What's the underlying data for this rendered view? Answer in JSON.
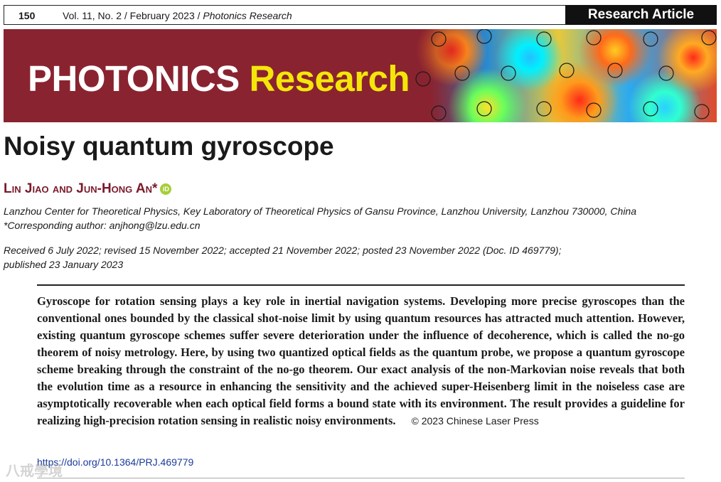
{
  "header": {
    "page_number": "150",
    "journal_ref": "Vol. 11, No. 2 / February 2023 / ",
    "journal_name": "Photonics Research",
    "article_type": "Research Article"
  },
  "banner": {
    "logo_part1": "PHOTONICS",
    "logo_part2": "Research"
  },
  "paper": {
    "title": "Noisy quantum gyroscope",
    "authors": "Lin Jiao and Jun-Hong An*",
    "orcid_badge": "iD",
    "affiliation": "Lanzhou Center for Theoretical Physics, Key Laboratory of Theoretical Physics of Gansu Province, Lanzhou University, Lanzhou 730000, China",
    "corresponding": "*Corresponding author: anjhong@lzu.edu.cn",
    "dates_line1": "Received 6 July 2022; revised 15 November 2022; accepted 21 November 2022; posted 23 November 2022 (Doc. ID 469779);",
    "dates_line2": "published 23 January 2023",
    "abstract": "Gyroscope for rotation sensing plays a key role in inertial navigation systems. Developing more precise gyroscopes than the conventional ones bounded by the classical shot-noise limit by using quantum resources has attracted much attention. However, existing quantum gyroscope schemes suffer severe deterioration under the influence of decoherence, which is called the no-go theorem of noisy metrology. Here, by using two quantized optical fields as the quantum probe, we propose a quantum gyroscope scheme breaking through the constraint of the no-go theorem. Our exact analysis of the non-Markovian noise reveals that both the evolution time as a resource in enhancing the sensitivity and the achieved super-Heisenberg limit in the noiseless case are asymptotically recoverable when each optical field forms a bound state with its environment. The result provides a guideline for realizing high-precision rotation sensing in realistic noisy environments.",
    "copyright": "© 2023 Chinese Laser Press",
    "doi": "https://doi.org/10.1364/PRJ.469779"
  },
  "watermark": "八戒學境",
  "colors": {
    "banner_bg": "#8a2330",
    "logo_yellow": "#f5e60a",
    "author_color": "#7a1a2a",
    "link_color": "#1a3a9a"
  }
}
